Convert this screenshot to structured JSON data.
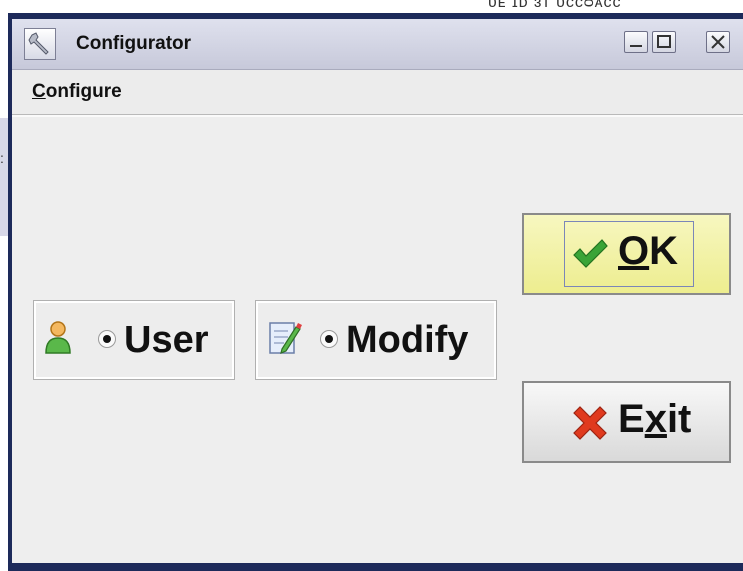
{
  "window": {
    "title": "Configurator"
  },
  "menubar": {
    "configure": {
      "mnemonic": "C",
      "rest": "onfigure"
    }
  },
  "options": {
    "user": {
      "label": "User",
      "selected": true
    },
    "modify": {
      "label": "Modify",
      "selected": true
    }
  },
  "buttons": {
    "ok": {
      "mnemonic": "O",
      "rest": "K"
    },
    "exit": {
      "pre": "E",
      "mnemonic": "x",
      "post": "it"
    }
  },
  "icons": {
    "app": "wrench-icon",
    "user": "user-icon",
    "modify": "edit-document-icon",
    "ok": "checkmark-icon",
    "exit": "red-x-icon",
    "minimize": "minimize-icon",
    "maximize": "maximize-icon",
    "close": "close-icon"
  },
  "colors": {
    "ok_button": "#f1f1a8",
    "check": "#3aa437",
    "exit_x": "#e03a1e",
    "window_frame": "#1d2a5a"
  }
}
